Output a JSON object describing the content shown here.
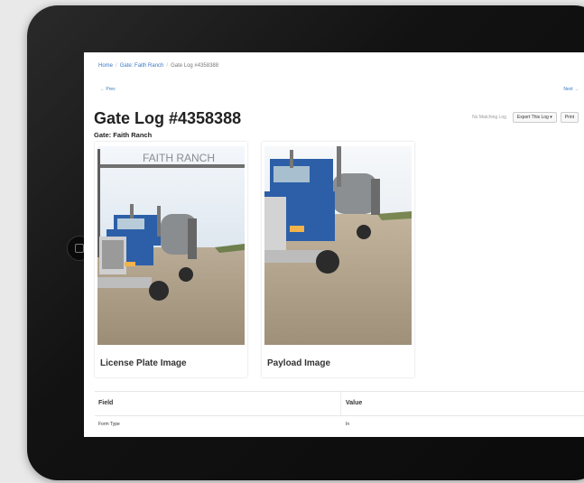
{
  "breadcrumb": {
    "home": "Home",
    "ranch": "Gate: Faith Ranch",
    "current": "Gate Log #4358388",
    "separator": "/"
  },
  "nav": {
    "prev": "← Prev",
    "next": "Next →"
  },
  "page": {
    "title": "Gate Log #4358388",
    "subtitle": "Gate: Faith Ranch"
  },
  "toolbar": {
    "no_matching": "No Matching Log",
    "export_label": "Export This Log ▾",
    "print_label": "Print"
  },
  "cards": [
    {
      "caption": "License Plate Image",
      "sign_text": "FAITH RANCH"
    },
    {
      "caption": "Payload Image"
    }
  ],
  "table": {
    "headers": [
      "Field",
      "Value"
    ],
    "rows": [
      {
        "field": "Form Type",
        "value": "In"
      }
    ]
  },
  "colors": {
    "link": "#3a78c3",
    "truck_blue": "#2c5fa8",
    "bezel": "#111111"
  }
}
